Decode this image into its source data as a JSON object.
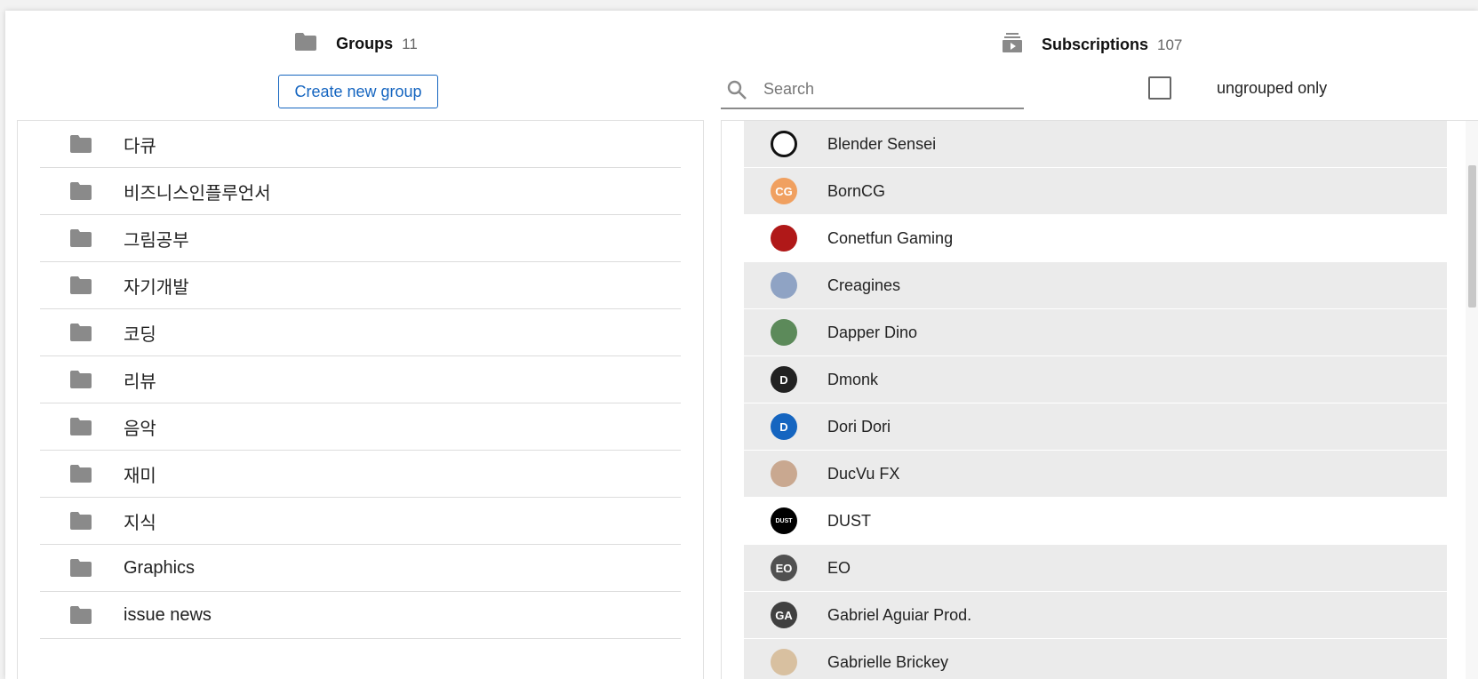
{
  "groups": {
    "title": "Groups",
    "count": "11",
    "create_label": "Create new group",
    "items": [
      {
        "label": "다큐"
      },
      {
        "label": "비즈니스인플루언서"
      },
      {
        "label": "그림공부"
      },
      {
        "label": "자기개발"
      },
      {
        "label": "코딩"
      },
      {
        "label": "리뷰"
      },
      {
        "label": "음악"
      },
      {
        "label": "재미"
      },
      {
        "label": "지식"
      },
      {
        "label": "Graphics"
      },
      {
        "label": "issue news"
      }
    ]
  },
  "subscriptions": {
    "title": "Subscriptions",
    "count": "107",
    "search_placeholder": "Search",
    "filter_label": "ungrouped only",
    "items": [
      {
        "label": "Blender Sensei",
        "selected": true,
        "avatar_color": "#ffffff",
        "avatar_text": ""
      },
      {
        "label": "BornCG",
        "selected": true,
        "avatar_color": "#f0a060",
        "avatar_text": "CG"
      },
      {
        "label": "Conetfun Gaming",
        "selected": false,
        "avatar_color": "#b01818",
        "avatar_text": ""
      },
      {
        "label": "Creagines",
        "selected": true,
        "avatar_color": "#8fa3c4",
        "avatar_text": ""
      },
      {
        "label": "Dapper Dino",
        "selected": true,
        "avatar_color": "#5c8a5a",
        "avatar_text": ""
      },
      {
        "label": "Dmonk",
        "selected": true,
        "avatar_color": "#222222",
        "avatar_text": "D"
      },
      {
        "label": "Dori Dori",
        "selected": true,
        "avatar_color": "#1565c0",
        "avatar_text": "D"
      },
      {
        "label": "DucVu FX",
        "selected": true,
        "avatar_color": "#c9a890",
        "avatar_text": ""
      },
      {
        "label": "DUST",
        "selected": false,
        "avatar_color": "#000000",
        "avatar_text": "DUST"
      },
      {
        "label": "EO",
        "selected": true,
        "avatar_color": "#505050",
        "avatar_text": "EO"
      },
      {
        "label": "Gabriel Aguiar Prod.",
        "selected": true,
        "avatar_color": "#404040",
        "avatar_text": "GA"
      },
      {
        "label": "Gabrielle Brickey",
        "selected": true,
        "avatar_color": "#d8c0a0",
        "avatar_text": ""
      }
    ]
  }
}
